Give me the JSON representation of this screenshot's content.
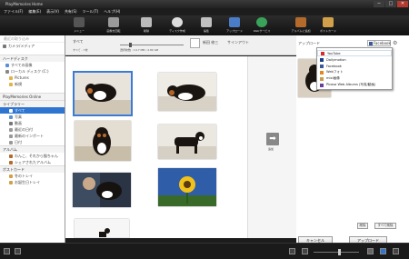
{
  "window": {
    "title": "PlayMemories Home",
    "minimize": "─",
    "maximize": "□",
    "close": "✕"
  },
  "menu": [
    "ファイル(F)",
    "編集(E)",
    "表示(V)",
    "共有(S)",
    "ツール(T)",
    "ヘルプ(H)"
  ],
  "toolbar": [
    {
      "label": "メニュー",
      "icon": "menu-icon",
      "color": "#555555"
    },
    {
      "label": "画像を回転",
      "icon": "rotate-icon",
      "color": "#9a9a9a"
    },
    {
      "label": "削除",
      "icon": "trash-icon",
      "color": "#bbbbbb"
    },
    {
      "label": "ディスク作成",
      "icon": "disc-icon",
      "color": "#dddddd"
    },
    {
      "label": "編集",
      "icon": "edit-icon",
      "color": "#c0c0c0"
    },
    {
      "label": "アップロード",
      "icon": "upload-icon",
      "color": "#4a7cc8"
    },
    {
      "label": "Webサービス",
      "icon": "globe-icon",
      "color": "#3aa35a"
    },
    {
      "label": "アルバムに追加",
      "icon": "album-icon",
      "color": "#b46a2b"
    },
    {
      "label": "ポストカード",
      "icon": "postcard-icon",
      "color": "#d2a04a"
    }
  ],
  "sidebar": {
    "head": "最近の取り込み",
    "camera": "カメラ/メディア",
    "hdd": "ハードディスク",
    "hdd_items": [
      "すべての画像",
      "ローカル ディスク (C:)",
      "Pictures",
      "新規"
    ],
    "pmo": "PlayMemories Online",
    "library": "ライブラリー",
    "library_items": [
      "すべて",
      "写真",
      "動画",
      "最近の日付",
      "最新のインポート",
      "日付"
    ],
    "album": "アルバム",
    "album_items": [
      "わんこ、それから猫ちゃん",
      "シェアされたアルバム"
    ],
    "postcard": "ポストカード",
    "postcard_items": [
      "冬のトレイ",
      "お誕生日トレイ"
    ]
  },
  "content": {
    "all_label": "すべて",
    "sub_label": "すべて - 7枚",
    "stats": "選択枚数 : 14.7 MB / 4.80 GB",
    "user": "新田 修三",
    "signout": "サインアウト",
    "add_label": "追加"
  },
  "upload": {
    "title": "アップロード",
    "service": "Facebook",
    "gear": "⚙"
  },
  "dropdown": [
    {
      "label": "YouTube",
      "color": "#d92b2b"
    },
    {
      "label": "Dailymotion",
      "color": "#1a3a8a"
    },
    {
      "label": "Facebook",
      "color": "#3b5998"
    },
    {
      "label": "Webフォト",
      "color": "#e6871e"
    },
    {
      "label": "mixi画像",
      "color": "#c89a4a"
    },
    {
      "label": "Picasa Web Albums (写真/動画)",
      "color": "#6b3e9e"
    }
  ],
  "actions": {
    "delete": "削除",
    "delete_all": "すべて削除",
    "cancel": "キャンセル",
    "upload": "アップロード"
  },
  "colors": {
    "accent": "#2f74d0",
    "chrome": "#1c1c1c"
  }
}
